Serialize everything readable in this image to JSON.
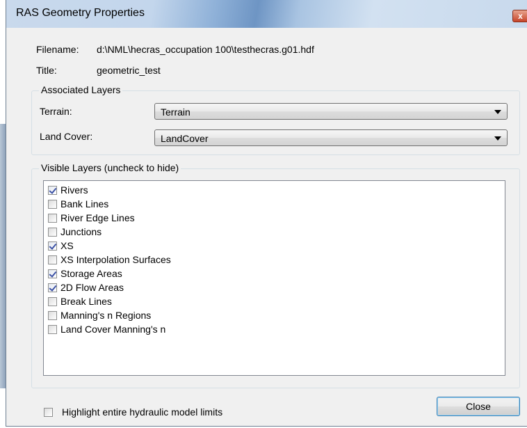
{
  "window": {
    "title": "RAS Geometry Properties",
    "close_glyph": "x"
  },
  "info": {
    "filename_label": "Filename:",
    "filename_value": "d:\\NML\\hecras_occupation 100\\testhecras.g01.hdf",
    "title_label": "Title:",
    "title_value": "geometric_test"
  },
  "associated_layers": {
    "legend": "Associated Layers",
    "terrain_label": "Terrain:",
    "terrain_value": "Terrain",
    "landcover_label": "Land Cover:",
    "landcover_value": "LandCover"
  },
  "visible_layers": {
    "legend": "Visible Layers (uncheck to hide)",
    "items": [
      {
        "label": "Rivers",
        "checked": true
      },
      {
        "label": "Bank Lines",
        "checked": false
      },
      {
        "label": "River Edge Lines",
        "checked": false
      },
      {
        "label": "Junctions",
        "checked": false
      },
      {
        "label": "XS",
        "checked": true
      },
      {
        "label": "XS Interpolation Surfaces",
        "checked": false
      },
      {
        "label": "Storage Areas",
        "checked": true
      },
      {
        "label": "2D Flow Areas",
        "checked": true
      },
      {
        "label": "Break Lines",
        "checked": false
      },
      {
        "label": "Manning's n Regions",
        "checked": false
      },
      {
        "label": "Land Cover Manning's n",
        "checked": false
      }
    ]
  },
  "footer": {
    "highlight_label": "Highlight entire hydraulic model limits",
    "highlight_checked": false,
    "close_label": "Close"
  },
  "colors": {
    "title_bar": "#c9d9ec",
    "dialog_bg": "#f0f0f0",
    "checkmark": "#3d52a5",
    "close_x": "#c6452a"
  }
}
